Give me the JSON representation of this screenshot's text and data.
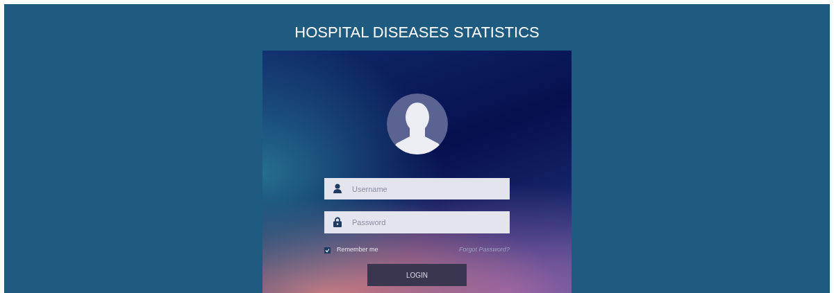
{
  "title": "HOSPITAL DISEASES STATISTICS",
  "login": {
    "username": {
      "placeholder": "Username"
    },
    "password": {
      "placeholder": "Password"
    },
    "remember": {
      "label": "Remember me",
      "checked": true
    },
    "forgot_link": "Forgot Password?",
    "button": "LOGIN"
  }
}
